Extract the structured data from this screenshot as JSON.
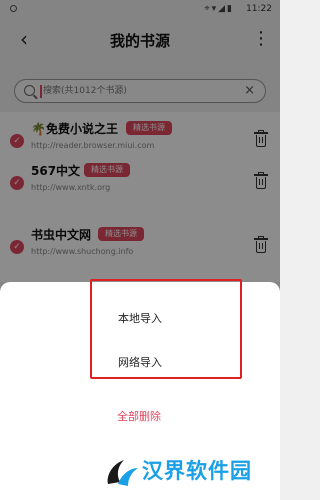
{
  "status_bar": {
    "time": "11:22",
    "icons": "⌖▾◢▮"
  },
  "app_bar": {
    "title": "我的书源",
    "back_glyph": "‹",
    "more_glyph": "⋮"
  },
  "search": {
    "placeholder": "搜索(共1012个书源)",
    "value": "",
    "clear_glyph": "×"
  },
  "sources": [
    {
      "name": "🌴免费小说之王",
      "badge": "精选书源",
      "url": "http://reader.browser.miui.com",
      "checked": true
    },
    {
      "name": "567中文",
      "badge": "精选书源",
      "url": "http://www.xntk.org",
      "checked": true
    },
    {
      "name": "书虫中文网",
      "badge": "精选书源",
      "url": "http://www.shuchong.info",
      "checked": true
    }
  ],
  "sheet": {
    "options": [
      {
        "label": "本地导入"
      },
      {
        "label": "网络导入"
      }
    ],
    "delete_all": "全部删除"
  },
  "watermark": {
    "text": "汉界软件园"
  },
  "colors": {
    "accent": "#e0465e",
    "highlight": "#e02020",
    "watermark": "#1aa0e6"
  }
}
